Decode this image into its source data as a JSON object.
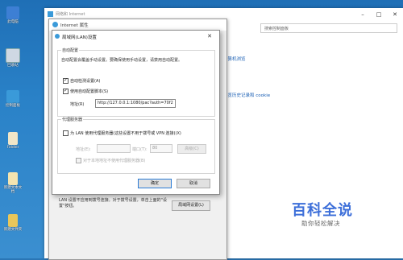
{
  "desktop": {
    "icons": [
      {
        "label": "此电脑",
        "color": "#3d7fd4"
      },
      {
        "label": "回收站",
        "color": "#cfd8e3"
      },
      {
        "label": "控制面板",
        "color": "#3a9ad9"
      },
      {
        "label": "Fiddler",
        "color": "#f1e6c8"
      },
      {
        "label": "新建文本文档",
        "color": "#f3e4b0"
      },
      {
        "label": "新建文件夹",
        "color": "#e8c65a"
      }
    ]
  },
  "control_panel": {
    "title": "网络和 Internet",
    "search_placeholder": "搜索控制面板",
    "links": [
      "通过计算机浏览",
      "删除浏览历史记录和 cookie"
    ]
  },
  "internet_properties": {
    "title": "Internet 属性",
    "lan_text": "LAN 设置不应用到拨号连接。对于拨号设置，单击上面的\"设置\"按钮。",
    "lan_button": "局域网设置(L)"
  },
  "lan_settings": {
    "title": "局域网(LAN)设置",
    "auto_config": {
      "legend": "自动配置",
      "note": "自动配置会覆盖手动设置。要确保使用手动设置，请禁用自动配置。",
      "auto_detect_label": "自动检测设置(A)",
      "auto_detect_checked": true,
      "script_label": "使用自动配置脚本(S)",
      "script_checked": true,
      "address_label": "地址(R)",
      "address_value": "http://127.0.0.1:1080/pac?auth=70f2"
    },
    "proxy": {
      "legend": "代理服务器",
      "use_proxy_label": "为 LAN 使用代理服务器(这些设置不用于拨号或 VPN 连接)(X)",
      "use_proxy_checked": false,
      "address_label": "地址(E):",
      "address_value": "",
      "port_label": "端口(T):",
      "port_value": "80",
      "advanced_button": "高级(C)",
      "bypass_label": "对于本地地址不使用代理服务器(B)",
      "bypass_checked": false
    },
    "ok_button": "确定",
    "cancel_button": "取消"
  },
  "watermark": {
    "main": "百科全说",
    "sub": "助你轻松解决"
  }
}
